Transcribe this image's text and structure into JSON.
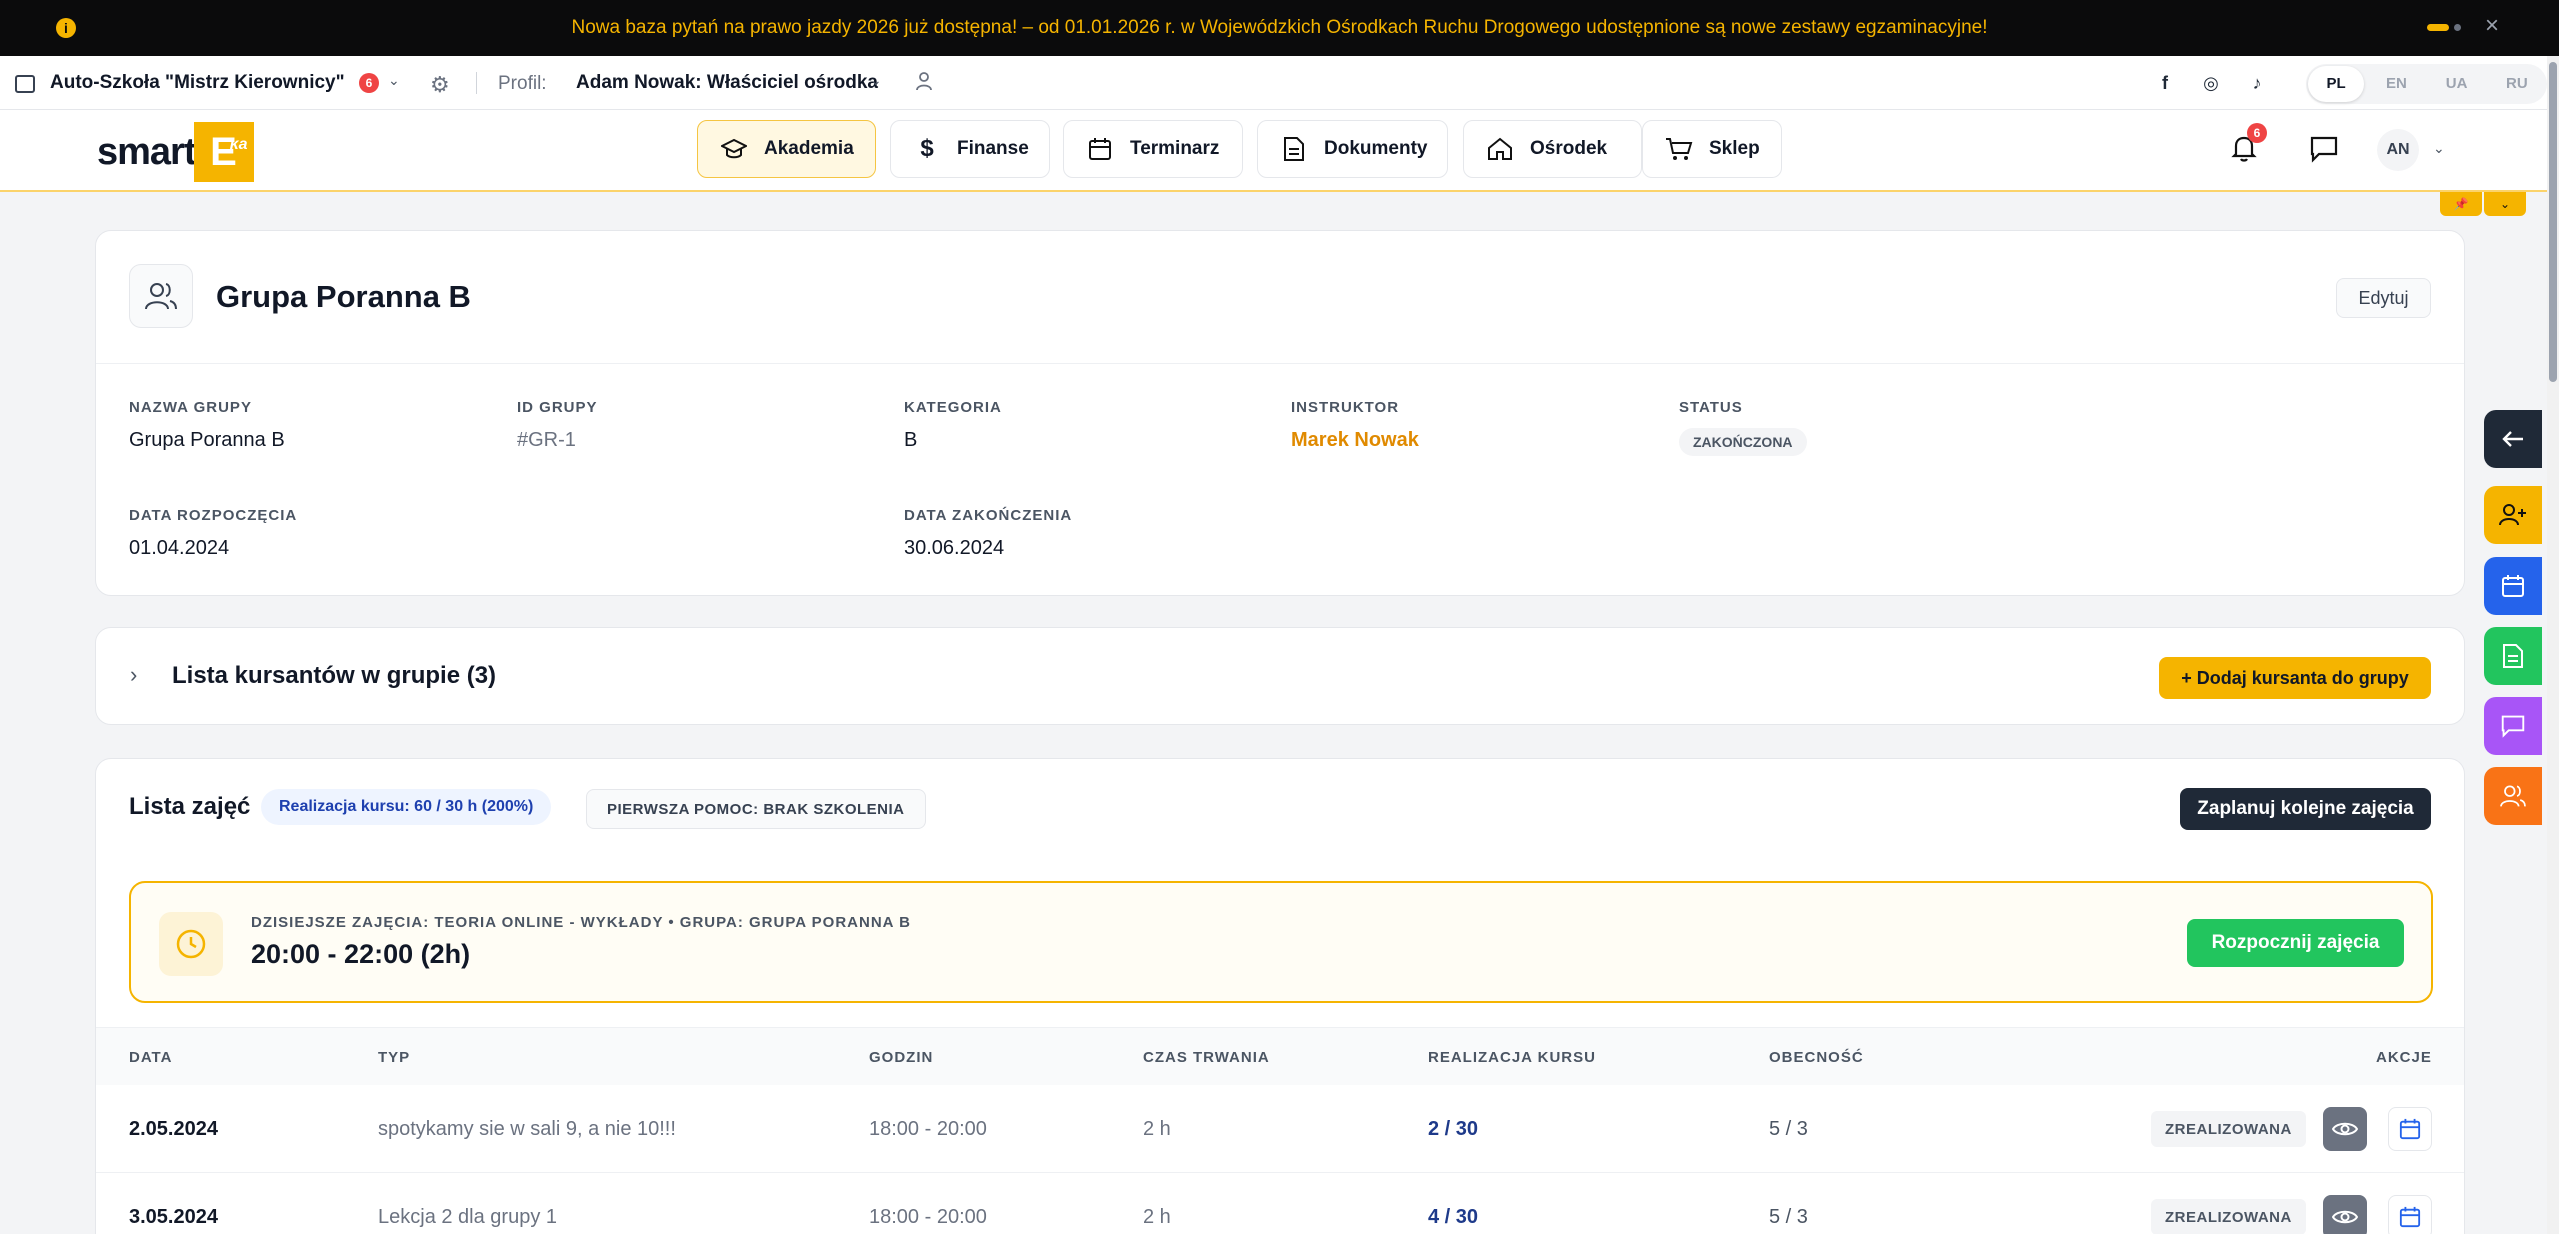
{
  "announcement": {
    "text": "Nowa baza pytań na prawo jazdy 2026 już dostępna! – od 01.01.2026 r. w Wojewódzkich Ośrodkach Ruchu Drogowego udostępnione są nowe zestawy egzaminacyjne!",
    "info_icon": "info-icon",
    "close": "×"
  },
  "topbar": {
    "school_name": "Auto-Szkoła \"Mistrz Kierownicy\"",
    "school_badge": "6",
    "profile_label": "Profil:",
    "profile_name": "Adam Nowak: Właściciel ośrodka",
    "social": [
      "f",
      "◎",
      "♪"
    ],
    "languages": [
      "PL",
      "EN",
      "UA",
      "RU"
    ],
    "active_language": "PL"
  },
  "header": {
    "logo_text": "smart",
    "logo_box": "E",
    "logo_sup": "ka",
    "nav": [
      {
        "label": "Akademia",
        "icon": "graduation-cap-icon",
        "active": true
      },
      {
        "label": "Finanse",
        "icon": "dollar-icon",
        "active": false
      },
      {
        "label": "Terminarz",
        "icon": "calendar-icon",
        "active": false
      },
      {
        "label": "Dokumenty",
        "icon": "document-icon",
        "active": false
      },
      {
        "label": "Ośrodek",
        "icon": "home-icon",
        "active": false
      },
      {
        "label": "Sklep",
        "icon": "cart-icon",
        "active": false
      }
    ],
    "notifications_badge": "6",
    "avatar_initials": "AN"
  },
  "group": {
    "title": "Grupa Poranna B",
    "edit_label": "Edytuj",
    "fields": {
      "name_label": "NAZWA GRUPY",
      "name_value": "Grupa Poranna B",
      "id_label": "ID GRUPY",
      "id_value": "#GR-1",
      "category_label": "KATEGORIA",
      "category_value": "B",
      "instructor_label": "INSTRUKTOR",
      "instructor_value": "Marek Nowak",
      "status_label": "STATUS",
      "status_value": "ZAKOŃCZONA",
      "start_label": "DATA ROZPOCZĘCIA",
      "start_value": "01.04.2024",
      "end_label": "DATA ZAKOŃCZENIA",
      "end_value": "30.06.2024"
    }
  },
  "students": {
    "title": "Lista kursantów w grupie (3)",
    "add_label": "+ Dodaj kursanta do grupy"
  },
  "classes": {
    "title": "Lista zajęć",
    "realization_pill": "Realizacja kursu: 60 / 30 h (200%)",
    "first_aid_pill": "PIERWSZA POMOC: BRAK SZKOLENIA",
    "plan_label": "Zaplanuj kolejne zajęcia",
    "today": {
      "label": "DZISIEJSZE ZAJĘCIA: TEORIA ONLINE - WYKŁADY • GRUPA: GRUPA PORANNA B",
      "time": "20:00 - 22:00 (2h)",
      "start_label": "Rozpocznij zajęcia"
    },
    "columns": [
      "DATA",
      "TYP",
      "GODZIN",
      "CZAS TRWANIA",
      "REALIZACJA KURSU",
      "OBECNOŚĆ",
      "AKCJE"
    ],
    "rows": [
      {
        "date": "2.05.2024",
        "type": "spotykamy sie w sali 9, a nie 10!!!",
        "hours": "18:00 - 20:00",
        "duration": "2 h",
        "realization": "2 / 30",
        "attendance": "5 / 3",
        "status": "ZREALIZOWANA"
      },
      {
        "date": "3.05.2024",
        "type": "Lekcja 2 dla grupy 1",
        "hours": "18:00 - 20:00",
        "duration": "2 h",
        "realization": "4 / 30",
        "attendance": "5 / 3",
        "status": "ZREALIZOWANA"
      }
    ]
  },
  "colors": {
    "accent": "#f5b400",
    "dark": "#1f2937",
    "green": "#22c55e",
    "blue": "#2563eb",
    "purple": "#a855f7",
    "orange": "#f97316",
    "red": "#ef4444"
  }
}
